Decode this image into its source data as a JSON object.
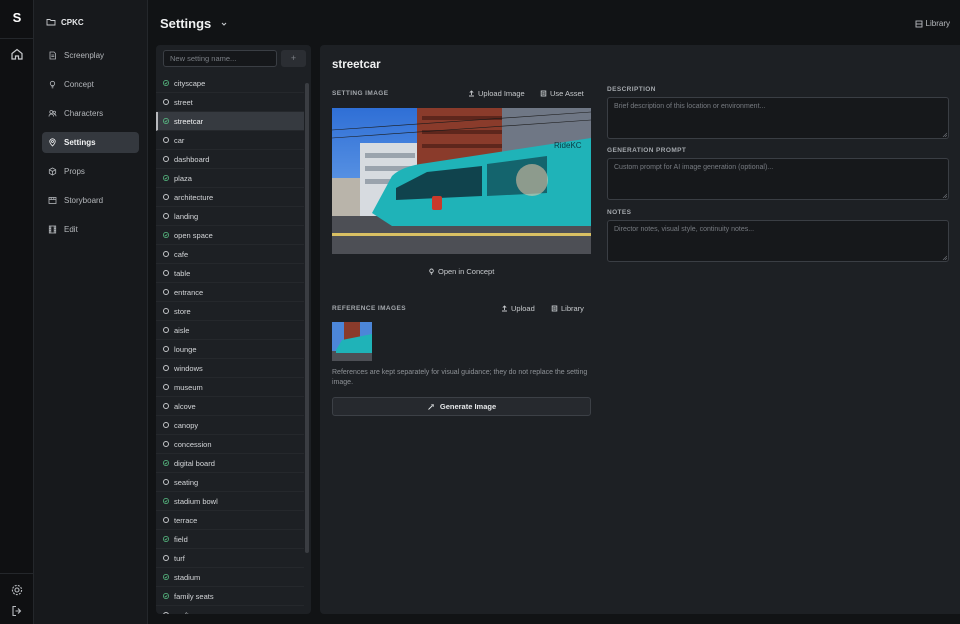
{
  "rail": {
    "logo": "S",
    "icons": [
      "home-icon",
      "gear-icon",
      "logout-icon"
    ]
  },
  "project": {
    "name": "CPKC"
  },
  "nav": [
    {
      "label": "Screenplay",
      "icon": "document-icon",
      "active": false
    },
    {
      "label": "Concept",
      "icon": "bulb-icon",
      "active": false
    },
    {
      "label": "Characters",
      "icon": "users-icon",
      "active": false
    },
    {
      "label": "Settings",
      "icon": "map-pin-icon",
      "active": true
    },
    {
      "label": "Props",
      "icon": "box-icon",
      "active": false
    },
    {
      "label": "Storyboard",
      "icon": "storyboard-icon",
      "active": false
    },
    {
      "label": "Edit",
      "icon": "film-icon",
      "active": false
    }
  ],
  "header": {
    "title": "Settings",
    "library": "Library"
  },
  "list": {
    "placeholder": "New setting name...",
    "add": "+",
    "items": [
      {
        "name": "cityscape",
        "status": "done"
      },
      {
        "name": "street",
        "status": "empty"
      },
      {
        "name": "streetcar",
        "status": "done",
        "selected": true
      },
      {
        "name": "car",
        "status": "empty"
      },
      {
        "name": "dashboard",
        "status": "empty"
      },
      {
        "name": "plaza",
        "status": "done"
      },
      {
        "name": "architecture",
        "status": "empty"
      },
      {
        "name": "landing",
        "status": "empty"
      },
      {
        "name": "open space",
        "status": "done"
      },
      {
        "name": "cafe",
        "status": "empty"
      },
      {
        "name": "table",
        "status": "empty"
      },
      {
        "name": "entrance",
        "status": "empty"
      },
      {
        "name": "store",
        "status": "empty"
      },
      {
        "name": "aisle",
        "status": "empty"
      },
      {
        "name": "lounge",
        "status": "empty"
      },
      {
        "name": "windows",
        "status": "empty"
      },
      {
        "name": "museum",
        "status": "empty"
      },
      {
        "name": "alcove",
        "status": "empty"
      },
      {
        "name": "canopy",
        "status": "empty"
      },
      {
        "name": "concession",
        "status": "empty"
      },
      {
        "name": "digital board",
        "status": "done"
      },
      {
        "name": "seating",
        "status": "empty"
      },
      {
        "name": "stadium bowl",
        "status": "done"
      },
      {
        "name": "terrace",
        "status": "empty"
      },
      {
        "name": "field",
        "status": "done"
      },
      {
        "name": "turf",
        "status": "empty"
      },
      {
        "name": "stadium",
        "status": "done"
      },
      {
        "name": "family seats",
        "status": "done"
      },
      {
        "name": "rooftop",
        "status": "empty"
      }
    ]
  },
  "editor": {
    "title": "streetcar",
    "setting_image_label": "SETTING IMAGE",
    "upload_image": "Upload Image",
    "use_asset": "Use Asset",
    "image_text": "RideKC",
    "open_in_concept": "Open in Concept",
    "reference_label": "REFERENCE IMAGES",
    "upload": "Upload",
    "library": "Library",
    "reference_note": "References are kept separately for visual guidance; they do not replace the setting image.",
    "generate": "Generate Image",
    "description_label": "DESCRIPTION",
    "description_placeholder": "Brief description of this location or environment...",
    "prompt_label": "GENERATION PROMPT",
    "prompt_placeholder": "Custom prompt for AI image generation (optional)...",
    "notes_label": "NOTES",
    "notes_placeholder": "Director notes, visual style, continuity notes..."
  },
  "colors": {
    "accent_check": "#5cc98a",
    "panel": "#1d2024",
    "background": "#111315"
  }
}
